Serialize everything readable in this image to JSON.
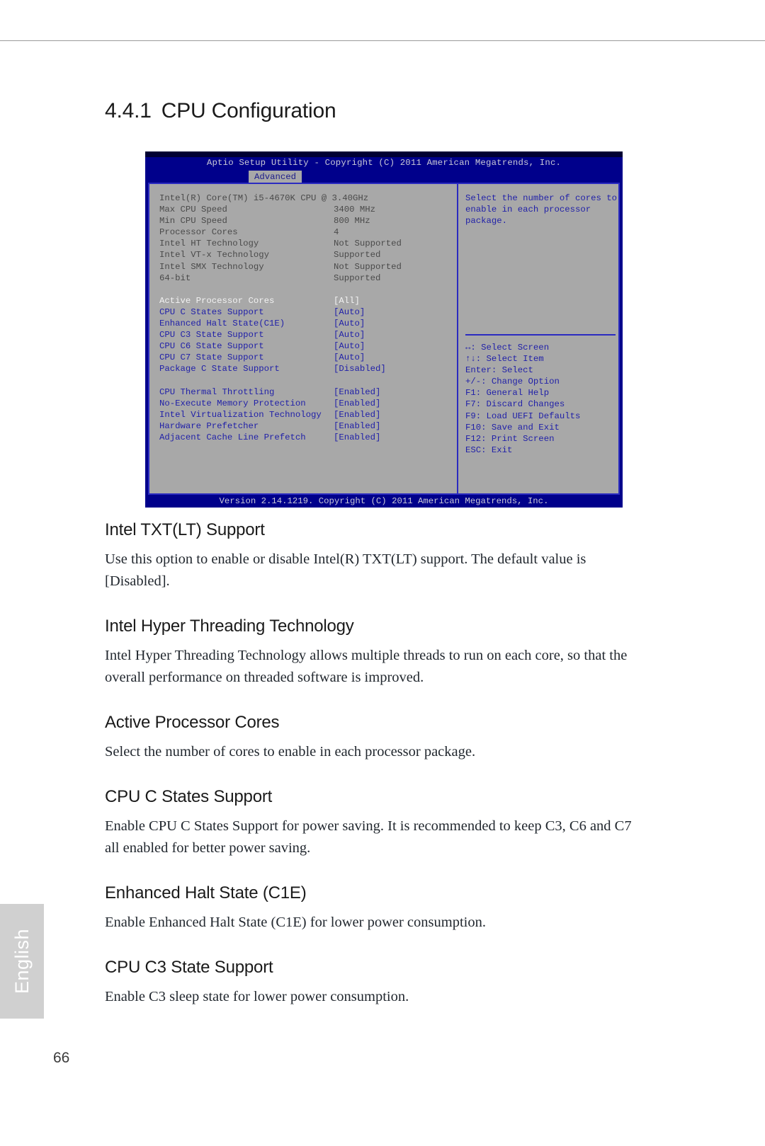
{
  "page": {
    "number": "66",
    "language_tab": "English"
  },
  "section": {
    "number": "4.4.1",
    "title": "CPU Configuration"
  },
  "bios": {
    "title": "Aptio Setup Utility - Copyright (C) 2011 American Megatrends, Inc.",
    "active_tab": "Advanced",
    "cpu_name": "Intel(R) Core(TM) i5-4670K CPU @ 3.40GHz",
    "info_rows": [
      {
        "label": "Max CPU Speed",
        "value": "3400 MHz"
      },
      {
        "label": "Min CPU Speed",
        "value": "800 MHz"
      },
      {
        "label": "Processor Cores",
        "value": "4"
      },
      {
        "label": "Intel HT Technology",
        "value": "Not Supported"
      },
      {
        "label": "Intel VT-x Technology",
        "value": "Supported"
      },
      {
        "label": "Intel SMX Technology",
        "value": "Not Supported"
      },
      {
        "label": "64-bit",
        "value": "Supported"
      }
    ],
    "settings_group_1": [
      {
        "label": "Active Processor Cores",
        "value": "[All]",
        "selected": true
      },
      {
        "label": "CPU C States Support",
        "value": "[Auto]",
        "selected": false
      },
      {
        "label": "Enhanced Halt State(C1E)",
        "value": "[Auto]",
        "selected": false
      },
      {
        "label": "CPU C3 State Support",
        "value": "[Auto]",
        "selected": false
      },
      {
        "label": "CPU C6 State Support",
        "value": "[Auto]",
        "selected": false
      },
      {
        "label": "CPU C7 State Support",
        "value": "[Auto]",
        "selected": false
      },
      {
        "label": "Package C State Support",
        "value": "[Disabled]",
        "selected": false
      }
    ],
    "settings_group_2": [
      {
        "label": "CPU Thermal Throttling",
        "value": "[Enabled]",
        "selected": false
      },
      {
        "label": "No-Execute Memory Protection",
        "value": "[Enabled]",
        "selected": false
      },
      {
        "label": "Intel Virtualization Technology",
        "value": "[Enabled]",
        "selected": false
      },
      {
        "label": "Hardware Prefetcher",
        "value": "[Enabled]",
        "selected": false
      },
      {
        "label": "Adjacent Cache Line Prefetch",
        "value": "[Enabled]",
        "selected": false
      }
    ],
    "help_text": "Select the number of cores to enable in each processor package.",
    "key_legend": [
      "↔: Select Screen",
      "↑↓: Select Item",
      "Enter: Select",
      "+/-: Change Option",
      "F1: General Help",
      "F7: Discard Changes",
      "F9: Load UEFI Defaults",
      "F10: Save and Exit",
      "F12: Print Screen",
      "ESC: Exit"
    ],
    "footer": "Version 2.14.1219. Copyright (C) 2011 American Megatrends, Inc."
  },
  "articles": [
    {
      "heading": "Intel TXT(LT) Support",
      "body": "Use this option to enable or disable Intel(R) TXT(LT) support. The default value is [Disabled]."
    },
    {
      "heading": "Intel Hyper Threading Technology",
      "body": "Intel Hyper Threading Technology allows multiple threads to run on each core, so that the overall performance on threaded software is improved."
    },
    {
      "heading": "Active Processor Cores",
      "body": "Select the number of cores to enable in each processor package."
    },
    {
      "heading": "CPU C States Support",
      "body": "Enable CPU C States Support for power saving. It is recommended to keep C3, C6 and C7 all enabled for better power saving."
    },
    {
      "heading": "Enhanced Halt State (C1E)",
      "body": "Enable Enhanced Halt State (C1E) for lower power consumption."
    },
    {
      "heading": "CPU C3 State Support",
      "body": "Enable C3 sleep state for lower power consumption."
    }
  ]
}
